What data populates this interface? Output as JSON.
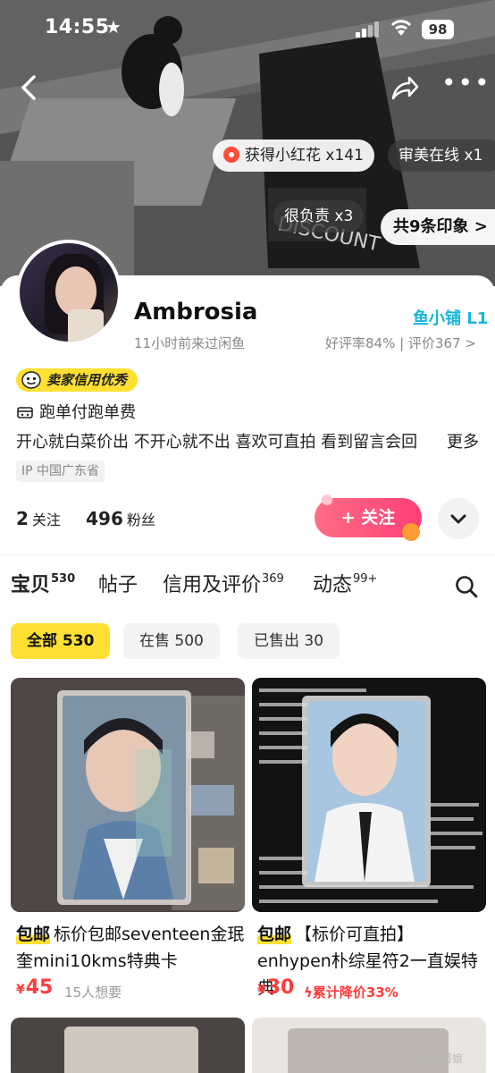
{
  "status_bar": {
    "time": "14:55",
    "battery": "98"
  },
  "hero": {
    "chips": {
      "flower": "获得小红花 x141",
      "aesthetic": "审美在线 x1",
      "responsible": "很负责 x3",
      "impressions": "共9条印象 >"
    }
  },
  "profile": {
    "username": "Ambrosia",
    "last_seen": "11小时前来过闲鱼",
    "shop_level": "鱼小铺 L1",
    "rating": "好评率84% | 评价367 >",
    "credit_badge": "卖家信用优秀",
    "free_shipping": "跑单付跑单费",
    "bio": "开心就白菜价出 不开心就不出 喜欢可直拍 看到留言会回",
    "bio_more": "更多",
    "ip": "IP 中国广东省",
    "following_count": "2",
    "following_label": "关注",
    "followers_count": "496",
    "followers_label": "粉丝",
    "follow_button": "+ 关注"
  },
  "tabs": [
    {
      "label": "宝贝",
      "count": "530"
    },
    {
      "label": "帖子",
      "count": ""
    },
    {
      "label": "信用及评价",
      "count": "369"
    },
    {
      "label": "动态",
      "count": "99+"
    }
  ],
  "filters": [
    {
      "label": "全部 530"
    },
    {
      "label": "在售 500"
    },
    {
      "label": "已售出 30"
    }
  ],
  "products": [
    {
      "tag": "包邮",
      "title": "标价包邮seventeen金珉奎mini10kms特典卡",
      "price": "45",
      "meta": "15人想要"
    },
    {
      "tag": "包邮",
      "title": "【标价可直拍】enhypen朴综星符2一直娱特典",
      "price": "30",
      "meta": "累计降价33%"
    }
  ],
  "watermark": "@李莓娘"
}
